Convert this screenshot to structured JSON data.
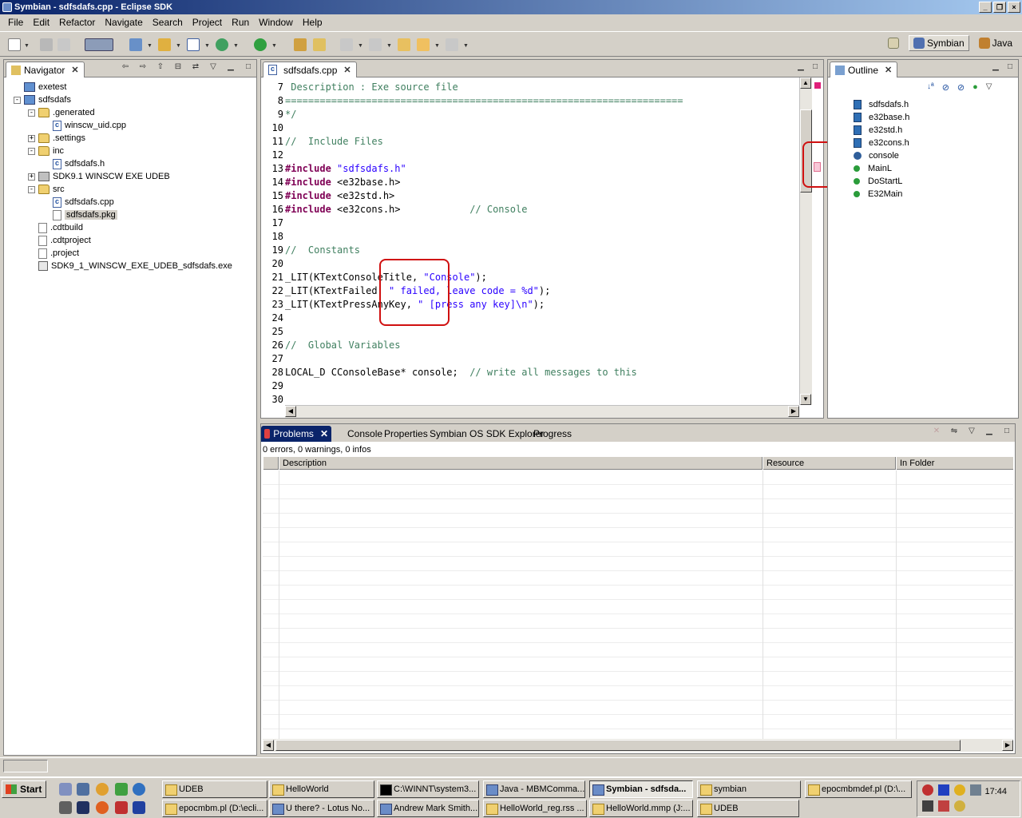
{
  "window": {
    "title": "Symbian - sdfsdafs.cpp - Eclipse SDK"
  },
  "menu": [
    "File",
    "Edit",
    "Refactor",
    "Navigate",
    "Search",
    "Project",
    "Run",
    "Window",
    "Help"
  ],
  "perspectives": [
    {
      "label": "Symbian",
      "active": true
    },
    {
      "label": "Java",
      "active": false
    }
  ],
  "navigator": {
    "tab": "Navigator",
    "items": [
      {
        "label": "exetest",
        "depth": 0,
        "icon": "project-icon",
        "expander": ""
      },
      {
        "label": "sdfsdafs",
        "depth": 0,
        "icon": "project-icon",
        "expander": "-"
      },
      {
        "label": ".generated",
        "depth": 1,
        "icon": "folder-icon",
        "expander": "-"
      },
      {
        "label": "winscw_uid.cpp",
        "depth": 2,
        "icon": "c-file-icon",
        "expander": ""
      },
      {
        "label": ".settings",
        "depth": 1,
        "icon": "folder-icon",
        "expander": "+"
      },
      {
        "label": "inc",
        "depth": 1,
        "icon": "folder-icon",
        "expander": "-"
      },
      {
        "label": "sdfsdafs.h",
        "depth": 2,
        "icon": "c-file-icon",
        "expander": ""
      },
      {
        "label": "SDK9.1 WINSCW EXE UDEB",
        "depth": 1,
        "icon": "sdk-icon",
        "expander": "+"
      },
      {
        "label": "src",
        "depth": 1,
        "icon": "folder-icon",
        "expander": "-"
      },
      {
        "label": "sdfsdafs.cpp",
        "depth": 2,
        "icon": "c-file-icon",
        "expander": ""
      },
      {
        "label": "sdfsdafs.pkg",
        "depth": 2,
        "icon": "file-icon",
        "expander": ""
      },
      {
        "label": ".cdtbuild",
        "depth": 1,
        "icon": "file-icon",
        "expander": ""
      },
      {
        "label": ".cdtproject",
        "depth": 1,
        "icon": "file-icon",
        "expander": ""
      },
      {
        "label": ".project",
        "depth": 1,
        "icon": "file-icon",
        "expander": ""
      },
      {
        "label": "SDK9_1_WINSCW_EXE_UDEB_sdfsdafs.exe",
        "depth": 1,
        "icon": "exe-icon",
        "expander": ""
      }
    ]
  },
  "editor": {
    "tab": "sdfsdafs.cpp",
    "lines": [
      {
        "n": "7",
        "segs": [
          {
            "t": " Description : Exe source file",
            "c": "cm"
          }
        ]
      },
      {
        "n": "8",
        "segs": [
          {
            "t": "=====================================================================",
            "c": "cm"
          }
        ]
      },
      {
        "n": "9",
        "segs": [
          {
            "t": "*/",
            "c": "cm"
          }
        ]
      },
      {
        "n": "10",
        "segs": []
      },
      {
        "n": "11",
        "segs": [
          {
            "t": "//  Include Files",
            "c": "cm"
          }
        ]
      },
      {
        "n": "12",
        "segs": []
      },
      {
        "n": "13",
        "segs": [
          {
            "t": "#include",
            "c": "kw"
          },
          {
            "t": " ",
            "c": ""
          },
          {
            "t": "\"sdfsdafs.h\"",
            "c": "st"
          }
        ]
      },
      {
        "n": "14",
        "segs": [
          {
            "t": "#include",
            "c": "kw"
          },
          {
            "t": " <e32base.h>",
            "c": ""
          }
        ]
      },
      {
        "n": "15",
        "segs": [
          {
            "t": "#include",
            "c": "kw"
          },
          {
            "t": " <e32std.h>",
            "c": ""
          }
        ]
      },
      {
        "n": "16",
        "segs": [
          {
            "t": "#include",
            "c": "kw"
          },
          {
            "t": " <e32cons.h>            ",
            "c": ""
          },
          {
            "t": "// Console",
            "c": "cm"
          }
        ]
      },
      {
        "n": "17",
        "segs": []
      },
      {
        "n": "18",
        "segs": []
      },
      {
        "n": "19",
        "segs": [
          {
            "t": "//  Constants",
            "c": "cm"
          }
        ]
      },
      {
        "n": "20",
        "segs": []
      },
      {
        "n": "21",
        "segs": [
          {
            "t": "_LIT(KTextConsoleTitle, ",
            "c": ""
          },
          {
            "t": "\"Console\"",
            "c": "st"
          },
          {
            "t": ");",
            "c": ""
          }
        ]
      },
      {
        "n": "22",
        "segs": [
          {
            "t": "_LIT(KTextFailed, ",
            "c": ""
          },
          {
            "t": "\" failed, leave code = %d\"",
            "c": "st"
          },
          {
            "t": ");",
            "c": ""
          }
        ]
      },
      {
        "n": "23",
        "segs": [
          {
            "t": "_LIT(KTextPressAnyKey, ",
            "c": ""
          },
          {
            "t": "\" [press any key]\\n\"",
            "c": "st"
          },
          {
            "t": ");",
            "c": ""
          }
        ]
      },
      {
        "n": "24",
        "segs": []
      },
      {
        "n": "25",
        "segs": []
      },
      {
        "n": "26",
        "segs": [
          {
            "t": "//  Global Variables",
            "c": "cm"
          }
        ]
      },
      {
        "n": "27",
        "segs": []
      },
      {
        "n": "28",
        "segs": [
          {
            "t": "LOCAL_D CConsoleBase* console;  ",
            "c": ""
          },
          {
            "t": "// write all messages to this",
            "c": "cm"
          }
        ]
      },
      {
        "n": "29",
        "segs": []
      },
      {
        "n": "30",
        "segs": []
      }
    ]
  },
  "outline": {
    "tab": "Outline",
    "items": [
      {
        "label": "sdfsdafs.h",
        "icon": "include-icon"
      },
      {
        "label": "e32base.h",
        "icon": "include-icon"
      },
      {
        "label": "e32std.h",
        "icon": "include-icon"
      },
      {
        "label": "e32cons.h",
        "icon": "include-icon"
      },
      {
        "label": "console",
        "icon": "variable-icon"
      },
      {
        "label": "MainL",
        "icon": "function-icon"
      },
      {
        "label": "DoStartL",
        "icon": "function-icon"
      },
      {
        "label": "E32Main",
        "icon": "function-icon"
      }
    ]
  },
  "bottom": {
    "tabs": [
      "Problems",
      "Console",
      "Properties",
      "Symbian OS SDK Explorer",
      "Progress"
    ],
    "summary": "0 errors, 0 warnings, 0 infos",
    "columns": [
      "Description",
      "Resource",
      "In Folder"
    ]
  },
  "taskbar": {
    "start": "Start",
    "row1": [
      {
        "label": "UDEB",
        "kind": "folder"
      },
      {
        "label": "HelloWorld",
        "kind": "folder"
      },
      {
        "label": "C:\\WINNT\\system3...",
        "kind": "cmd"
      },
      {
        "label": "Java - MBMComma...",
        "kind": "app"
      },
      {
        "label": "Symbian - sdfsda...",
        "kind": "app",
        "active": true
      },
      {
        "label": "symbian",
        "kind": "folder"
      },
      {
        "label": "epocmbmdef.pl (D:\\...",
        "kind": "file"
      }
    ],
    "row2": [
      {
        "label": "epocmbm.pl (D:\\ecli...",
        "kind": "file"
      },
      {
        "label": "U there? - Lotus No...",
        "kind": "app"
      },
      {
        "label": "Andrew Mark Smith...",
        "kind": "app"
      },
      {
        "label": "HelloWorld_reg.rss ...",
        "kind": "file"
      },
      {
        "label": "HelloWorld.mmp (J:...",
        "kind": "file"
      },
      {
        "label": "UDEB",
        "kind": "folder"
      }
    ],
    "clock": "17:44"
  }
}
